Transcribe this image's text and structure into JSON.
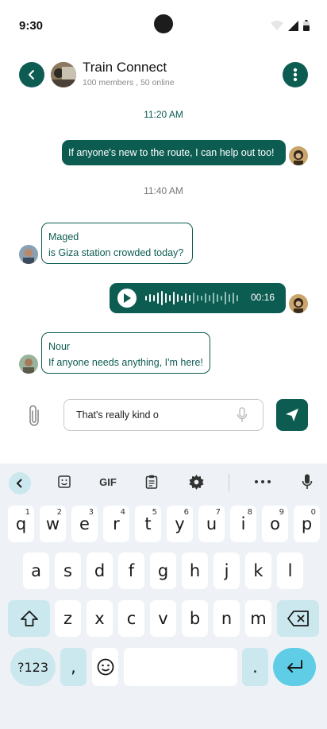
{
  "status": {
    "time": "9:30"
  },
  "header": {
    "title": "Train Connect",
    "subtitle": "100 members , 50 online"
  },
  "messages": {
    "ts1": "11:20 AM",
    "msg1": "If anyone's new to the route, I can help out too!",
    "ts2": "11:40 AM",
    "msg2_sender": "Maged",
    "msg2_text": "is Giza station crowded today?",
    "voice_duration": "00:16",
    "msg3_sender": "Nour",
    "msg3_text": "If anyone needs anything, I'm here!"
  },
  "composer": {
    "value": "That's really kind o"
  },
  "keyboard": {
    "toolbar_gif": "GIF",
    "row1": [
      {
        "k": "q",
        "s": "1"
      },
      {
        "k": "w",
        "s": "2"
      },
      {
        "k": "e",
        "s": "3"
      },
      {
        "k": "r",
        "s": "4"
      },
      {
        "k": "t",
        "s": "5"
      },
      {
        "k": "y",
        "s": "6"
      },
      {
        "k": "u",
        "s": "7"
      },
      {
        "k": "i",
        "s": "8"
      },
      {
        "k": "o",
        "s": "9"
      },
      {
        "k": "p",
        "s": "0"
      }
    ],
    "row2": [
      "a",
      "s",
      "d",
      "f",
      "g",
      "h",
      "j",
      "k",
      "l"
    ],
    "row3": [
      "z",
      "x",
      "c",
      "v",
      "b",
      "n",
      "m"
    ],
    "symbols_label": "?123",
    "comma": ",",
    "period": "."
  },
  "colors": {
    "primary": "#0d5c52",
    "keyboard_bg": "#eef2f7",
    "enter": "#5ecde5",
    "func_key": "#cbe8ee"
  },
  "icons": [
    "back-arrow-icon",
    "more-vert-icon",
    "play-icon",
    "attach-icon",
    "mic-icon",
    "send-icon",
    "chevron-left-icon",
    "sticker-icon",
    "clipboard-icon",
    "gear-icon",
    "more-horiz-icon",
    "shift-icon",
    "backspace-icon",
    "emoji-icon",
    "enter-icon"
  ]
}
